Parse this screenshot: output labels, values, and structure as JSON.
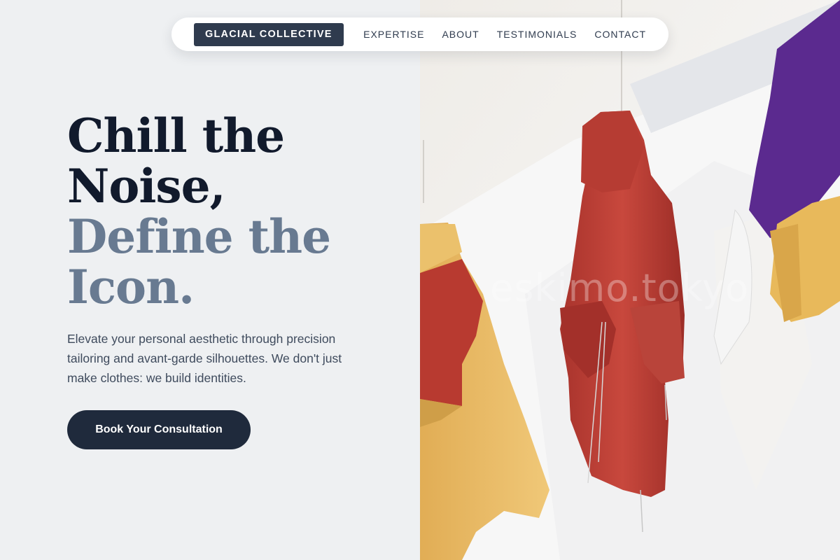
{
  "nav": {
    "brand": "GLACIAL COLLECTIVE",
    "links": [
      "EXPERTISE",
      "ABOUT",
      "TESTIMONIALS",
      "CONTACT"
    ]
  },
  "hero": {
    "title_line1": "Chill the",
    "title_line2": "Noise,",
    "title_line3": "Define the",
    "title_line4": "Icon.",
    "description": "Elevate your personal aesthetic through precision tailoring and avant-garde silhouettes. We don't just make clothes: we build identities.",
    "cta_label": "Book Your Consultation"
  },
  "image": {
    "watermark": "eskimo.tokyo",
    "subject": "hanging-jackets-photo"
  },
  "colors": {
    "brand_bg": "#2f3b4e",
    "title_dark": "#111a2c",
    "title_muted": "#687a91",
    "cta_bg": "#1f2a3c",
    "page_bg": "#eef0f2"
  }
}
